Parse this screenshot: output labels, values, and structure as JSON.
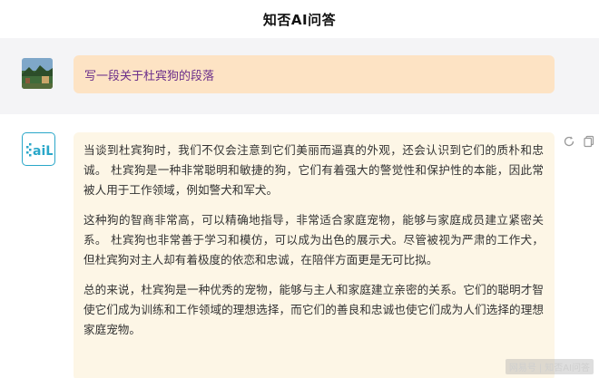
{
  "header": {
    "title": "知否AI问答"
  },
  "user": {
    "message": "写一段关于杜宾狗的段落"
  },
  "ai": {
    "paragraphs": [
      "当谈到杜宾狗时，我们不仅会注意到它们美丽而逼真的外观，还会认识到它们的质朴和忠诚。 杜宾狗是一种非常聪明和敏捷的狗，它们有着强大的警觉性和保护性的本能，因此常被人用于工作领域，例如警犬和军犬。",
      "这种狗的智商非常高，可以精确地指导，非常适合家庭宠物，能够与家庭成员建立紧密关系。 杜宾狗也非常善于学习和模仿，可以成为出色的展示犬。尽管被视为严肃的工作犬，但杜宾狗对主人却有着极度的依恋和忠诚，在陪伴方面更是无可比拟。",
      "总的来说，杜宾狗是一种优秀的宠物，能够与主人和家庭建立亲密的关系。它们的聪明才智使它们成为训练和工作领域的理想选择，而它们的善良和忠诚也使它们成为人们选择的理想家庭宠物。"
    ],
    "avatar_label": "aiL"
  },
  "watermark": {
    "left": "网易号",
    "separator": "|",
    "right": "知否AI问答"
  },
  "icons": {
    "regenerate": "refresh-icon",
    "copy": "copy-icon"
  },
  "colors": {
    "user_bubble": "#fde3c4",
    "ai_bubble": "#fdf6e6",
    "accent": "#2aa7c9"
  }
}
